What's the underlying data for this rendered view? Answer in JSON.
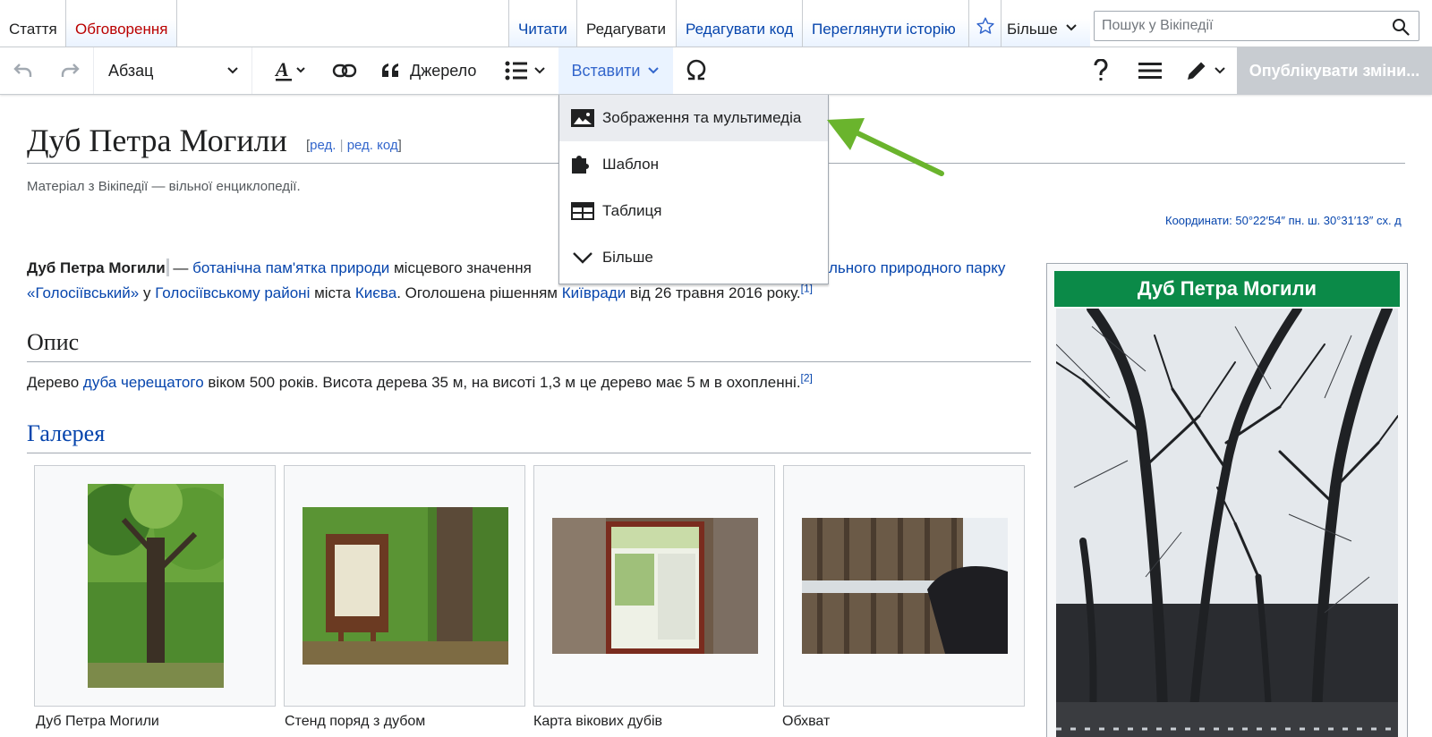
{
  "tabs": {
    "article": "Стаття",
    "talk": "Обговорення",
    "read": "Читати",
    "edit": "Редагувати",
    "edit_source": "Редагувати код",
    "history": "Переглянути історію",
    "more": "Більше"
  },
  "search": {
    "placeholder": "Пошук у Вікіпедії",
    "value": ""
  },
  "toolbar": {
    "paragraph_format": "Абзац",
    "cite_label": "Джерело",
    "insert_label": "Вставити",
    "publish_label": "Опублікувати зміни..."
  },
  "insert_menu": {
    "items": [
      {
        "label": "Зображення та мультимедіа",
        "icon": "image-icon"
      },
      {
        "label": "Шаблон",
        "icon": "puzzle-icon"
      },
      {
        "label": "Таблиця",
        "icon": "table-icon"
      },
      {
        "label": "Більше",
        "icon": "chevron-down-icon"
      }
    ]
  },
  "article": {
    "title": "Дуб Петра Могили",
    "edit_link_open": "[",
    "edit_link": "ред.",
    "edit_link_sep": " | ",
    "edit_source_link": "ред. код",
    "edit_link_close": "]",
    "tagline": "Матеріал з Вікіпедії — вільної енциклопедії.",
    "coords_label": "Координати:",
    "coords_value": "50°22′54″ пн. ш. 30°31′13″ сх. д",
    "intro": {
      "bold": "Дуб Петра Могили",
      "dash": " — ",
      "link1": "ботанічна пам'ятка природи",
      "text1": " місцевого значення",
      "link2_tail": "льного природного парку",
      "link3": "«Голосіївський»",
      "text2": " у ",
      "link4": "Голосіївському районі",
      "text3": " міста ",
      "link5": "Києва",
      "text4": ". Оголошена рішенням ",
      "link6": "Київради",
      "text5": " від 26 травня 2016 року.",
      "ref": "[1]"
    },
    "section_description": "Опис",
    "description": {
      "text1": "Дерево ",
      "link1": "дуба черещатого",
      "text2": " віком 500 років. Висота дерева 35 м, на висоті 1,3 м це дерево має 5 м в охопленні.",
      "ref": "[2]"
    },
    "section_gallery": "Галерея",
    "gallery": [
      {
        "caption": "Дуб Петра Могили"
      },
      {
        "caption": "Стенд поряд з дубом"
      },
      {
        "caption": "Карта вікових дубів"
      },
      {
        "caption": "Обхват"
      }
    ]
  },
  "infobox": {
    "title": "Дуб Петра Могили"
  },
  "colors": {
    "link": "#0645ad",
    "red_link": "#ba0000",
    "infobox_header": "#0b8a48",
    "active_tool": "#3366cc",
    "arrow": "#6ab42d"
  }
}
